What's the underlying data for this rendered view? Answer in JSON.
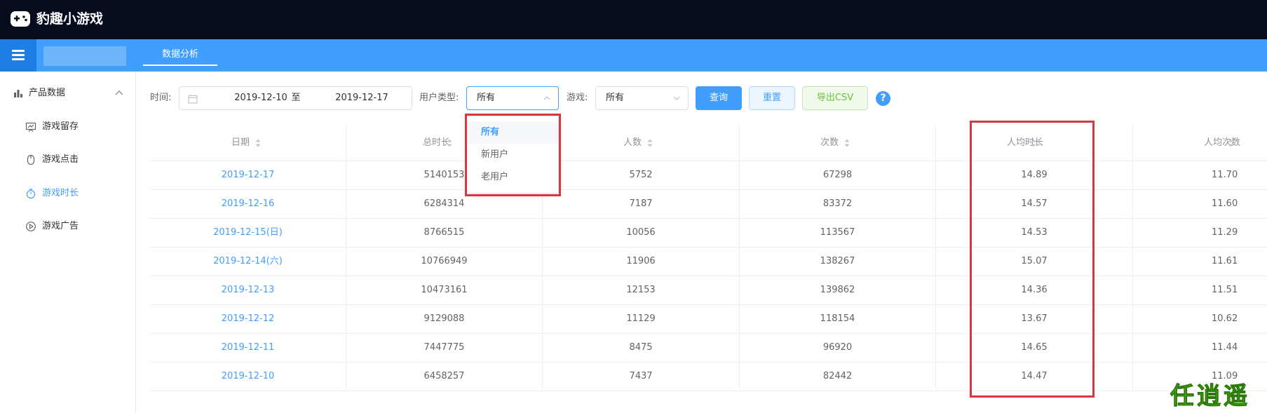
{
  "header": {
    "title": "豹趣小游戏"
  },
  "nav": {
    "tab_label": "数据分析"
  },
  "sidebar": {
    "group_label": "产品数据",
    "items": [
      {
        "label": "游戏留存",
        "icon": "chart-board-icon",
        "active": false
      },
      {
        "label": "游戏点击",
        "icon": "mouse-icon",
        "active": false
      },
      {
        "label": "游戏时长",
        "icon": "timer-icon",
        "active": true
      },
      {
        "label": "游戏广告",
        "icon": "play-circle-icon",
        "active": false
      }
    ]
  },
  "filters": {
    "time_label": "时间:",
    "date_start": "2019-12-10",
    "date_separator": "至",
    "date_end": "2019-12-17",
    "user_type_label": "用户类型:",
    "user_type_value": "所有",
    "game_label": "游戏:",
    "game_value": "所有",
    "query_label": "查询",
    "reset_label": "重置",
    "export_label": "导出CSV",
    "help_label": "?"
  },
  "dropdown": {
    "options": [
      "所有",
      "新用户",
      "老用户"
    ],
    "selected": "所有"
  },
  "table": {
    "columns": [
      "日期",
      "总时长",
      "人数",
      "次数",
      "人均时长",
      "人均次数"
    ],
    "rows": [
      [
        "2019-12-17",
        "5140153",
        "5752",
        "67298",
        "14.89",
        "11.70"
      ],
      [
        "2019-12-16",
        "6284314",
        "7187",
        "83372",
        "14.57",
        "11.60"
      ],
      [
        "2019-12-15(日)",
        "8766515",
        "10056",
        "113567",
        "14.53",
        "11.29"
      ],
      [
        "2019-12-14(六)",
        "10766949",
        "11906",
        "138267",
        "15.07",
        "11.61"
      ],
      [
        "2019-12-13",
        "10473161",
        "12153",
        "139862",
        "14.36",
        "11.51"
      ],
      [
        "2019-12-12",
        "9129088",
        "11129",
        "118154",
        "13.67",
        "10.62"
      ],
      [
        "2019-12-11",
        "7447775",
        "8475",
        "96920",
        "14.65",
        "11.44"
      ],
      [
        "2019-12-10",
        "6458257",
        "7437",
        "82442",
        "14.47",
        "11.09"
      ]
    ]
  },
  "watermark": "任逍遥",
  "colors": {
    "header_bg": "#060b1e",
    "nav_bg": "#409eff",
    "primary": "#409eff",
    "annotation_red": "#d9363e"
  }
}
